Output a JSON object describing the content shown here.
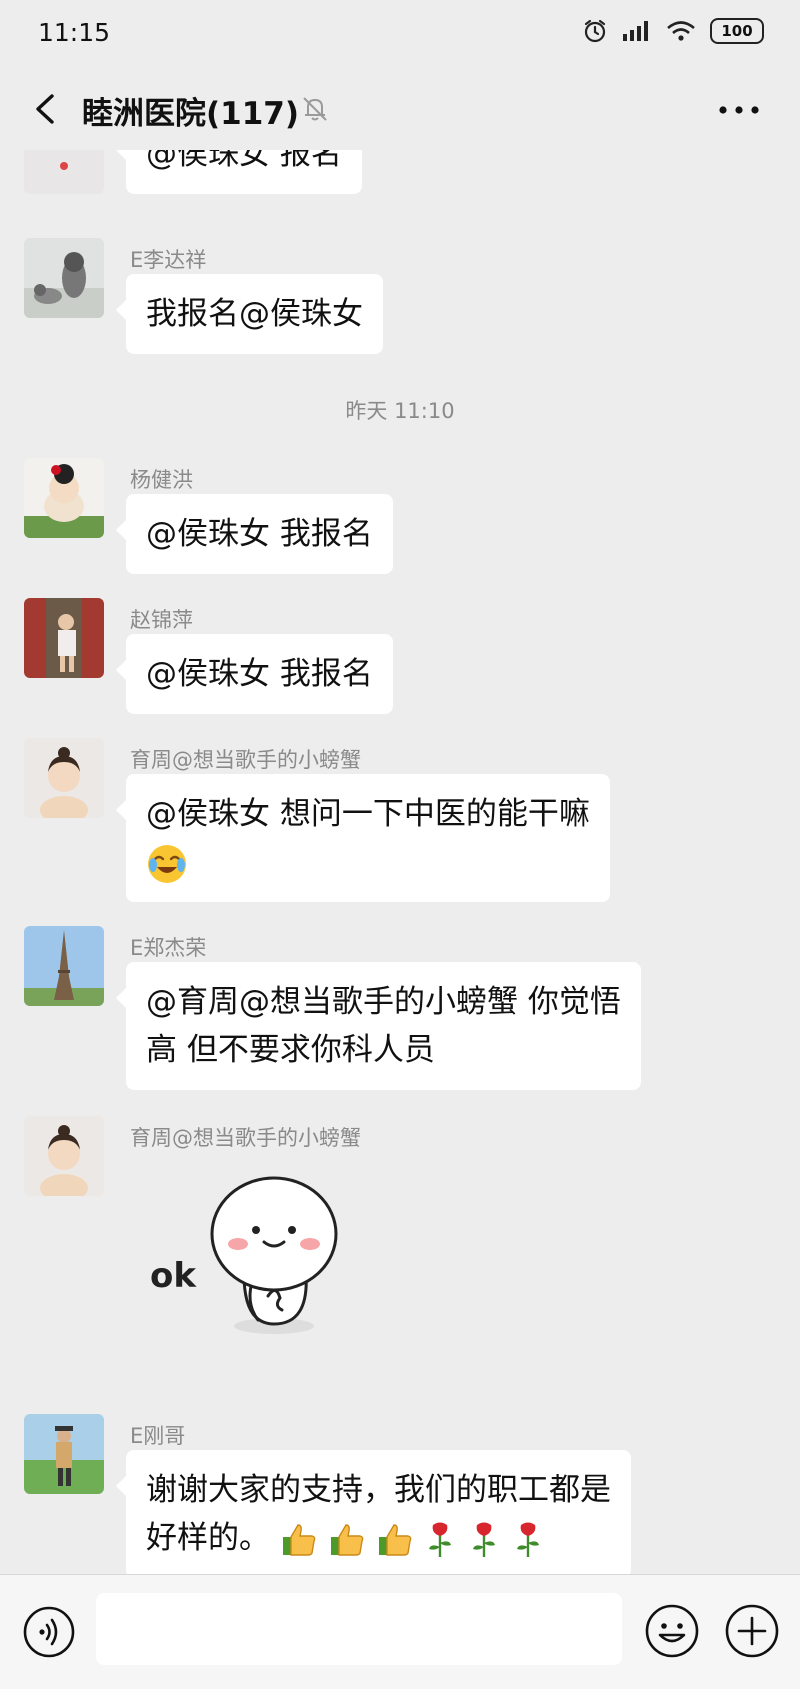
{
  "status_bar": {
    "time": "11:15",
    "battery": "100"
  },
  "header": {
    "title": "睦洲医院(117)"
  },
  "messages": [
    {
      "sender": "",
      "text": "@侯珠女  报名"
    },
    {
      "sender": "E李达祥",
      "text": "我报名@侯珠女"
    },
    {
      "sender": "杨健洪",
      "text": "@侯珠女  我报名"
    },
    {
      "sender": "赵锦萍",
      "text": "@侯珠女  我报名"
    },
    {
      "sender": "育周@想当歌手的小螃蟹",
      "line1": "@侯珠女  想问一下中医的能干嘛"
    },
    {
      "sender": "E郑杰荣",
      "line1": "@育周@想当歌手的小螃蟹  你觉悟",
      "line2": "高 但不要求你科人员"
    },
    {
      "sender": "育周@想当歌手的小螃蟹",
      "sticker_text": "ok"
    },
    {
      "sender": "E刚哥",
      "line1": "谢谢大家的支持，我们的职工都是",
      "line2": "好样的。"
    }
  ],
  "time_divider": "昨天 11:10",
  "input": {
    "value": ""
  },
  "icons": {
    "back": "back-arrow-icon",
    "mute": "bell-off-icon",
    "more": "more-dots-icon",
    "voice": "voice-icon",
    "emoji": "emoji-icon",
    "plus": "plus-icon"
  }
}
